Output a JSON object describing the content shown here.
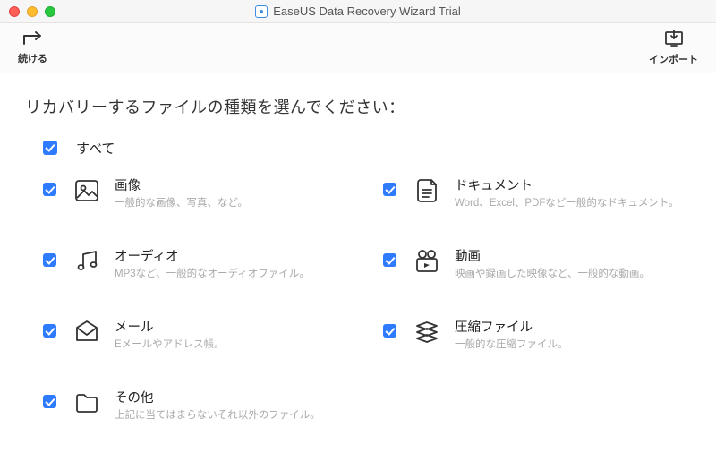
{
  "window": {
    "title": "EaseUS Data Recovery Wizard Trial"
  },
  "toolbar": {
    "continue_label": "続ける",
    "import_label": "インポート"
  },
  "heading": "リカバリーするファイルの種類を選んでください：",
  "all_label": "すべて",
  "items": {
    "image": {
      "title": "画像",
      "desc": "一般的な画像、写真、など。"
    },
    "document": {
      "title": "ドキュメント",
      "desc": "Word、Excel、PDFなど一般的なドキュメント。"
    },
    "audio": {
      "title": "オーディオ",
      "desc": "MP3など、一般的なオーディオファイル。"
    },
    "video": {
      "title": "動画",
      "desc": "映画や録画した映像など、一般的な動画。"
    },
    "mail": {
      "title": "メール",
      "desc": "Eメールやアドレス帳。"
    },
    "archive": {
      "title": "圧縮ファイル",
      "desc": "一般的な圧縮ファイル。"
    },
    "other": {
      "title": "その他",
      "desc": "上記に当てはまらないそれ以外のファイル。"
    }
  }
}
